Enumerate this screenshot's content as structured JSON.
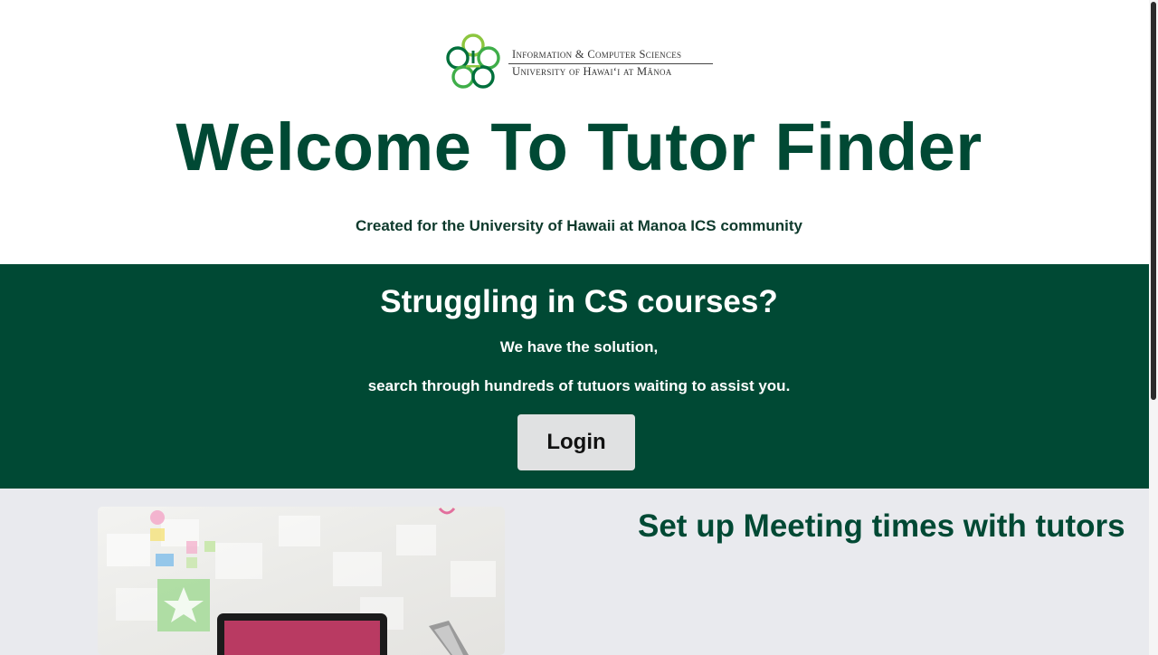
{
  "logo": {
    "line1": "Information & Computer Sciences",
    "line2": "University of Hawai‘i at Mānoa"
  },
  "header": {
    "title": "Welcome To Tutor Finder",
    "subtitle": "Created for the University of Hawaii at Manoa ICS community"
  },
  "hero": {
    "heading": "Struggling in CS courses?",
    "line1": "We have the solution,",
    "line2": "search through hundreds of tutuors waiting to assist you.",
    "login_label": "Login"
  },
  "features": {
    "heading": "Set up Meeting times with tutors"
  },
  "colors": {
    "brand_green": "#004934",
    "hero_background": "#004934",
    "feature_background": "#e9eaee",
    "login_button": "#e0e1e2"
  }
}
